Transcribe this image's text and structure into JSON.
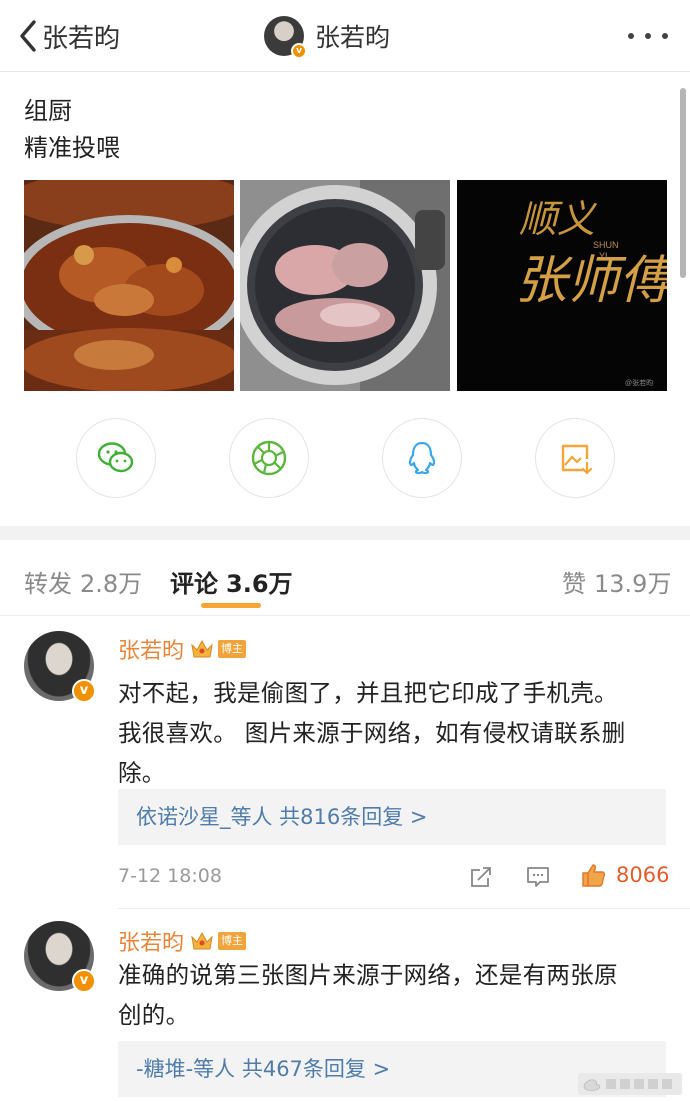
{
  "header": {
    "back_label": "张若昀",
    "user_name": "张若昀",
    "more_icon": "more-icon"
  },
  "post": {
    "lines": [
      "组厨",
      "精准投喂"
    ],
    "images": [
      "braised-meat-photo",
      "pot-of-meat-photo",
      "calligraphy-poster"
    ],
    "poster_text": {
      "title_top": "顺义",
      "title_main": "张师傅",
      "subtitle_top": "SHUN",
      "subtitle_bottom": "YI",
      "credit": "@张若昀"
    }
  },
  "share": {
    "items": [
      {
        "name": "wechat-icon",
        "color": "#3fb035"
      },
      {
        "name": "moments-icon",
        "color": "#5ab63c"
      },
      {
        "name": "qq-icon",
        "color": "#3aa7e8"
      },
      {
        "name": "save-image-icon",
        "color": "#f2a53a"
      }
    ]
  },
  "tabs": {
    "repost_label": "转发",
    "repost_count": "2.8万",
    "comment_label": "评论",
    "comment_count": "3.6万",
    "like_label": "赞",
    "like_count": "13.9万"
  },
  "comments": [
    {
      "name": "张若昀",
      "author_tag": "博主",
      "text_lines": [
        "对不起，我是偷图了，并且把它印成了手机壳。",
        "我很喜欢。 图片来源于网络，如有侵权请联系删",
        "除。"
      ],
      "replies_text": "依诺沙星_等人  共816条回复 >",
      "time": "7-12 18:08",
      "likes": "8066"
    },
    {
      "name": "张若昀",
      "author_tag": "博主",
      "text_lines": [
        "准确的说第三张图片来源于网络，还是有两张原",
        "创的。"
      ],
      "replies_text": "-糖堆-等人  共467条回复 >"
    }
  ],
  "colors": {
    "accent": "#f7a533",
    "name_color": "#e8853a",
    "link": "#4f7cab",
    "like": "#e35d2b"
  }
}
